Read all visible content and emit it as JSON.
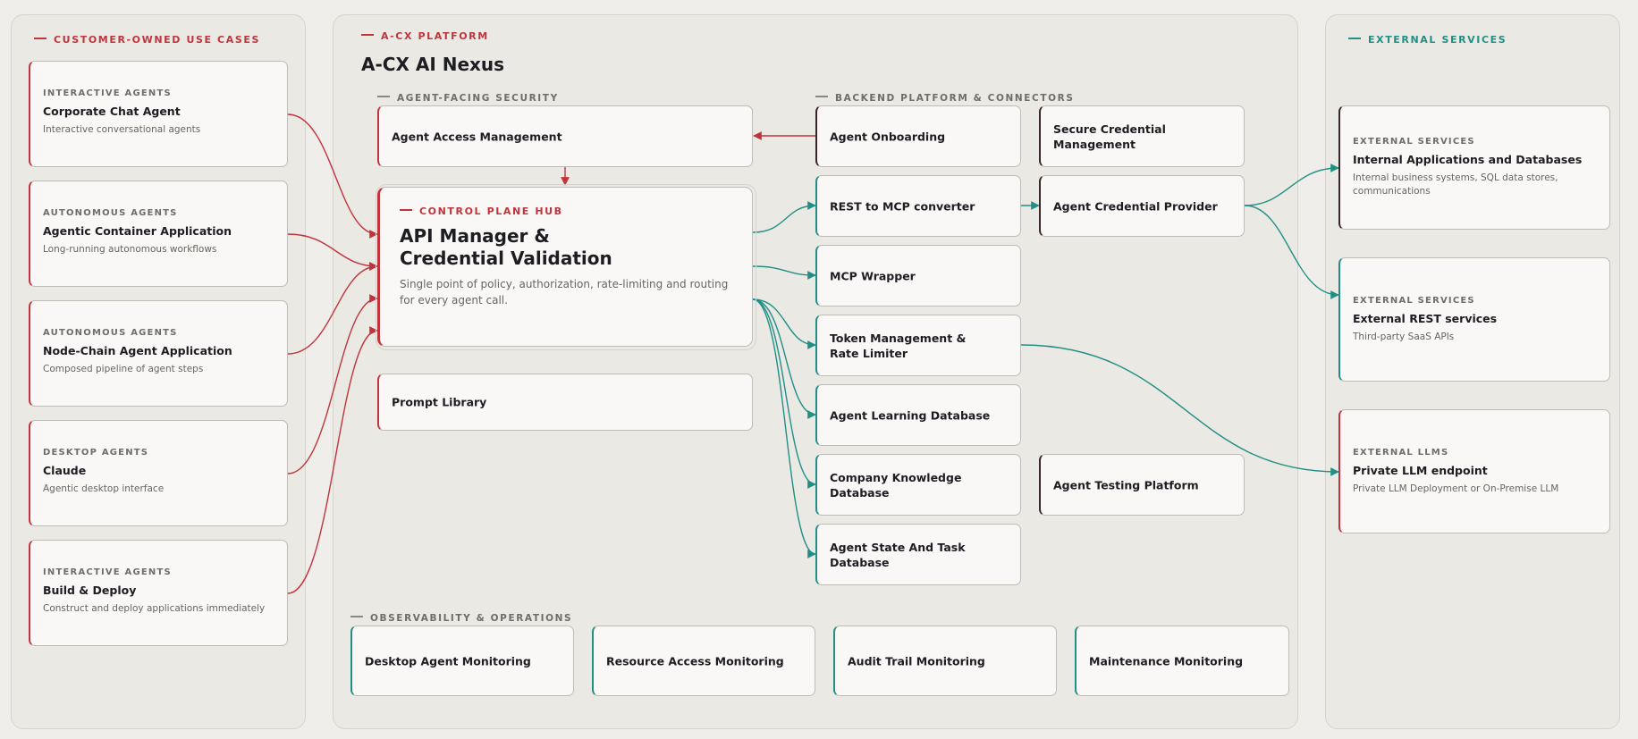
{
  "colors": {
    "customer_accent": "#c0343c",
    "external_accent": "#218f86",
    "backend_accent": "#3a2529",
    "background": "#f0eeea",
    "panel": "#ebe9e4",
    "card": "#f9f8f6"
  },
  "left_panel": {
    "label": "CUSTOMER-OWNED USE CASES",
    "cards": [
      {
        "kicker": "INTERACTIVE AGENTS",
        "title": "Corporate Chat Agent",
        "desc": "Interactive conversational agents"
      },
      {
        "kicker": "AUTONOMOUS AGENTS",
        "title": "Agentic Container Application",
        "desc": "Long-running autonomous workflows"
      },
      {
        "kicker": "AUTONOMOUS AGENTS",
        "title": "Node-Chain Agent Application",
        "desc": "Composed pipeline of agent steps"
      },
      {
        "kicker": "DESKTOP AGENTS",
        "title": "Claude",
        "desc": "Agentic desktop interface"
      },
      {
        "kicker": "INTERACTIVE AGENTS",
        "title": "Build & Deploy",
        "desc": "Construct and deploy applications immediately"
      }
    ]
  },
  "platform": {
    "label": "A-CX PLATFORM",
    "title": "A-CX AI Nexus",
    "security_label": "AGENT-FACING SECURITY",
    "backend_label": "BACKEND PLATFORM & CONNECTORS",
    "observability_label": "OBSERVABILITY & OPERATIONS",
    "agent_access": "Agent Access Management",
    "hub": {
      "kicker": "CONTROL PLANE HUB",
      "title": "API Manager &\nCredential Validation",
      "desc": "Single point of policy, authorization, rate-limiting and routing for every agent call."
    },
    "prompt_library": "Prompt Library",
    "backend": {
      "agent_onboarding": "Agent Onboarding",
      "secure_credential": "Secure Credential Management",
      "rest_mcp": "REST to MCP converter",
      "credential_provider": "Agent Credential Provider",
      "mcp_wrapper": "MCP Wrapper",
      "token_mgmt": "Token Management &\nRate Limiter",
      "learning_db": "Agent Learning Database",
      "knowledge_db": "Company Knowledge Database",
      "testing_platform": "Agent Testing Platform",
      "state_db": "Agent State And Task Database"
    },
    "observability": [
      "Desktop Agent Monitoring",
      "Resource Access Monitoring",
      "Audit Trail Monitoring",
      "Maintenance Monitoring"
    ]
  },
  "right_panel": {
    "label": "EXTERNAL SERVICES",
    "cards": [
      {
        "kicker": "EXTERNAL SERVICES",
        "title": "Internal Applications and Databases",
        "desc": "Internal business systems, SQL data stores, communications"
      },
      {
        "kicker": "EXTERNAL SERVICES",
        "title": "External REST services",
        "desc": "Third-party SaaS APIs"
      },
      {
        "kicker": "EXTERNAL LLMS",
        "title": "Private LLM endpoint",
        "desc": "Private LLM Deployment or On-Premise LLM"
      }
    ]
  }
}
